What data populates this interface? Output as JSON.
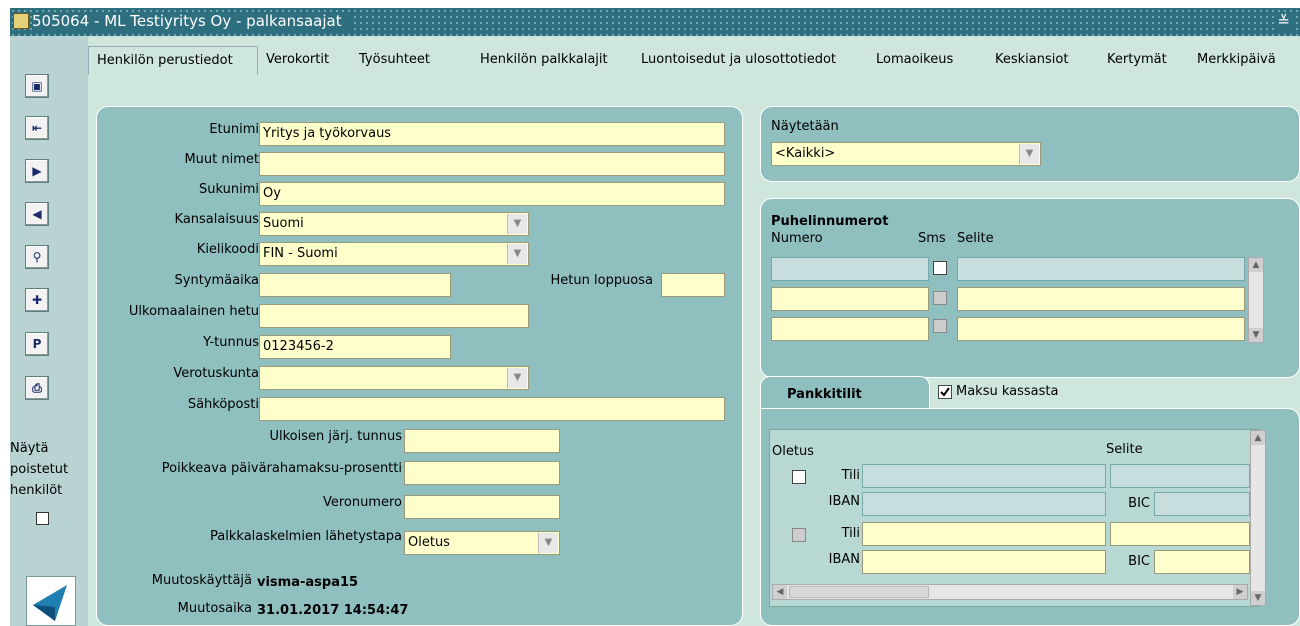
{
  "window": {
    "title": "505064 - ML Testiyritys Oy - palkansaajat",
    "minimize": "≚"
  },
  "toolbar": {
    "buttons": [
      {
        "name": "save-icon",
        "glyph": "▣"
      },
      {
        "name": "exit-icon",
        "glyph": "⇤"
      },
      {
        "name": "next-icon",
        "glyph": "▶"
      },
      {
        "name": "previous-icon",
        "glyph": "◀"
      },
      {
        "name": "search-icon",
        "glyph": "⚲"
      },
      {
        "name": "new-record-icon",
        "glyph": "✚"
      },
      {
        "name": "p-button",
        "glyph": "P"
      },
      {
        "name": "print-icon",
        "glyph": "⎙"
      }
    ],
    "show_deleted_label_1": "Näytä",
    "show_deleted_label_2": "poistetut",
    "show_deleted_label_3": "henkilöt"
  },
  "tabs": [
    "Henkilön perustiedot",
    "Verokortit",
    "Työsuhteet",
    "Henkilön palkkalajit",
    "Luontoisedut ja ulosottotiedot",
    "Lomaoikeus",
    "Keskiansiot",
    "Kertymät",
    "Merkkipäivä"
  ],
  "person": {
    "etunimi_label": "Etunimi",
    "etunimi": "Yritys ja työkorvaus",
    "muut_label": "Muut nimet",
    "muut": "",
    "sukunimi_label": "Sukunimi",
    "sukunimi": "Oy",
    "kansalaisuus_label": "Kansalaisuus",
    "kansalaisuus": "Suomi",
    "kielikoodi_label": "Kielikoodi",
    "kielikoodi": "FIN - Suomi",
    "syntyma_label": "Syntymäaika",
    "syntyma": "",
    "hetu_label": "Hetun loppuosa",
    "hetu": "",
    "ulkomaalainen_label": "Ulkomaalainen hetu",
    "ulkomaalainen": "",
    "ytunnus_label": "Y-tunnus",
    "ytunnus": "0123456-2",
    "verotuskunta_label": "Verotuskunta",
    "verotuskunta": "",
    "sahkoposti_label": "Sähköposti",
    "sahkoposti": "",
    "ulkoisen_label": "Ulkoisen järj. tunnus",
    "ulkoisen": "",
    "poikkeava_label": "Poikkeava päivärahamaksu-prosentti",
    "poikkeava": "",
    "veronumero_label": "Veronumero",
    "veronumero": "",
    "lahetystapa_label": "Palkkalaskelmien lähetystapa",
    "lahetystapa": "Oletus",
    "muutoskayttaja_label": "Muutoskäyttäjä",
    "muutoskayttaja": "visma-aspa15",
    "muutosaika_label": "Muutosaika",
    "muutosaika": "31.01.2017 14:54:47"
  },
  "naytetaan": {
    "label": "Näytetään",
    "value": "<Kaikki>"
  },
  "phones": {
    "title": "Puhelinnumerot",
    "col_numero": "Numero",
    "col_sms": "Sms",
    "col_selite": "Selite"
  },
  "bank": {
    "tab_label": "Pankkitilit",
    "maksu_kassasta": "Maksu kassasta",
    "col_oletus": "Oletus",
    "col_selite": "Selite",
    "tili": "Tili",
    "iban": "IBAN",
    "bic": "BIC"
  }
}
